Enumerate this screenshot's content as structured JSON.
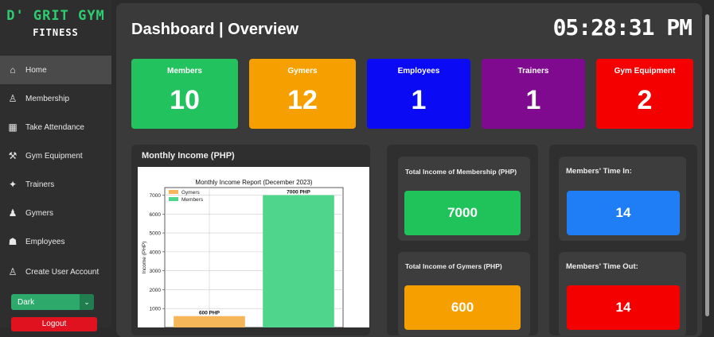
{
  "app": {
    "brand_line1": "D' GRIT GYM",
    "brand_line2": "FITNESS"
  },
  "header": {
    "title": "Dashboard | Overview",
    "clock": "05:28:31 PM"
  },
  "sidebar": {
    "items": [
      {
        "label": "Home",
        "icon": "home-icon"
      },
      {
        "label": "Membership",
        "icon": "user-icon"
      },
      {
        "label": "Take Attendance",
        "icon": "attendance-icon"
      },
      {
        "label": "Gym Equipment",
        "icon": "dumbbell-icon"
      },
      {
        "label": "Trainers",
        "icon": "trainer-icon"
      },
      {
        "label": "Gymers",
        "icon": "group-icon"
      },
      {
        "label": "Employees",
        "icon": "employee-icon"
      },
      {
        "label": "Create User Account",
        "icon": "user-add-icon"
      }
    ],
    "theme": "Dark",
    "logout": "Logout"
  },
  "cards": [
    {
      "label": "Members",
      "value": "10",
      "color": "#22c35e"
    },
    {
      "label": "Gymers",
      "value": "12",
      "color": "#f5a000"
    },
    {
      "label": "Employees",
      "value": "1",
      "color": "#0a0af5"
    },
    {
      "label": "Trainers",
      "value": "1",
      "color": "#7f0a8f"
    },
    {
      "label": "Gym Equipment",
      "value": "2",
      "color": "#f50000"
    }
  ],
  "income_panel": {
    "title": "Monthly Income (PHP)"
  },
  "totals": {
    "membership_label": "Total Income of Membership (PHP)",
    "membership_value": "7000",
    "gymers_label": "Total Income of Gymers (PHP)",
    "gymers_value": "600"
  },
  "time": {
    "in_label": "Members' Time In:",
    "in_value": "14",
    "out_label": "Members' Time Out:",
    "out_value": "14"
  },
  "chart_data": {
    "type": "bar",
    "title": "Monthly Income Report (December 2023)",
    "ylabel": "Income (PHP)",
    "xlabel": "",
    "ylim": [
      0,
      7400
    ],
    "yticks": [
      1000,
      2000,
      3000,
      4000,
      5000,
      6000,
      7000
    ],
    "series": [
      {
        "name": "Gymers",
        "value": 600,
        "label": "600 PHP",
        "color": "#f5b65a"
      },
      {
        "name": "Members",
        "value": 7000,
        "label": "7000 PHP",
        "color": "#4fd68c"
      }
    ],
    "legend": "top-left"
  }
}
